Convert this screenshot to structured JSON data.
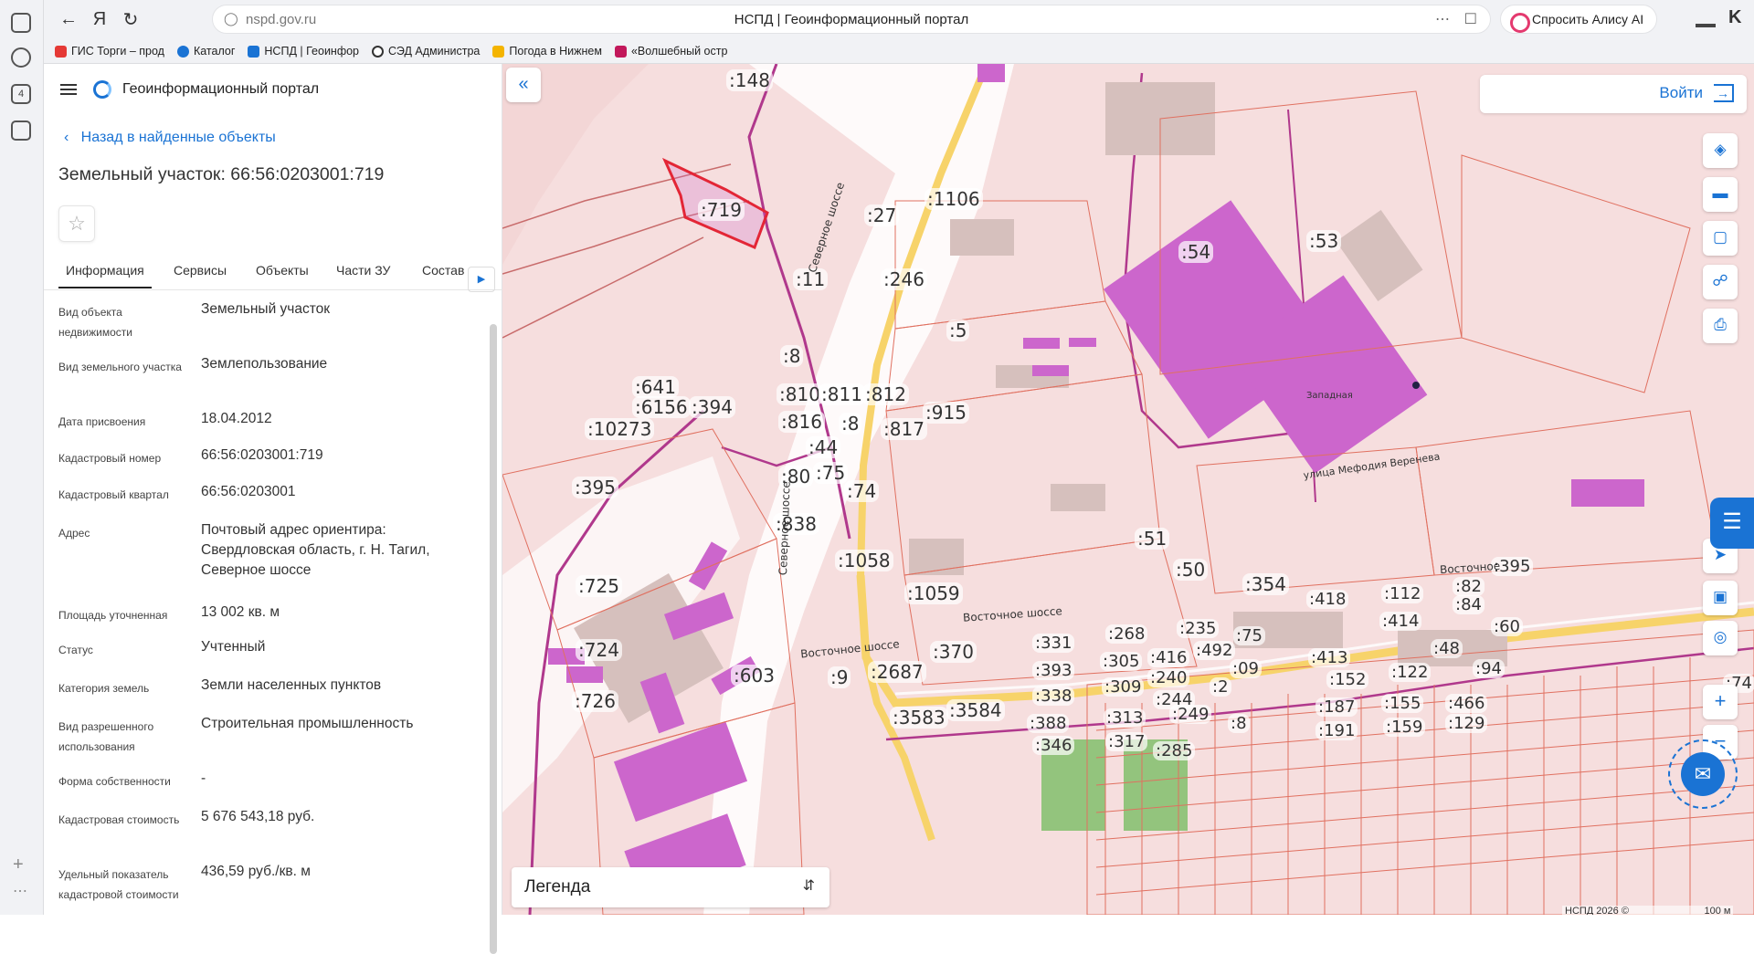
{
  "browser": {
    "url": "nspd.gov.ru",
    "tab_title": "НСПД | Геоинформационный портал",
    "alice_label": "Спросить Алису AI",
    "bookmarks": [
      {
        "label": "ГИС Торги – прод",
        "color": "#e53935"
      },
      {
        "label": "Каталог",
        "color": "#1a73d4"
      },
      {
        "label": "НСПД | Геоинфор",
        "color": "#1a73d4"
      },
      {
        "label": "СЭД Администра",
        "color": "#333333"
      },
      {
        "label": "Погода в Нижнем",
        "color": "#f4b400"
      },
      {
        "label": "«Волшебный остр",
        "color": "#c2185b"
      }
    ],
    "left_rail_tab_count": "4"
  },
  "sidebar": {
    "app_title": "Геоинформационный портал",
    "back_label": "Назад в найденные объекты",
    "object_title": "Земельный участок: 66:56:0203001:719",
    "tabs": [
      "Информация",
      "Сервисы",
      "Объекты",
      "Части ЗУ",
      "Состав"
    ],
    "rows": [
      {
        "label": "Вид объекта недвижимости",
        "value": "Земельный участок"
      },
      {
        "label": "Вид земельного участка",
        "value": "Землепользование"
      },
      {
        "label": "Дата присвоения",
        "value": "18.04.2012"
      },
      {
        "label": "Кадастровый номер",
        "value": "66:56:0203001:719"
      },
      {
        "label": "Кадастровый квартал",
        "value": "66:56:0203001"
      },
      {
        "label": "Адрес",
        "value": "Почтовый адрес ориентира: Свердловская область, г. Н. Тагил, Северное шоссе"
      },
      {
        "label": "Площадь уточненная",
        "value": "13 002 кв. м"
      },
      {
        "label": "Статус",
        "value": "Учтенный"
      },
      {
        "label": "Категория земель",
        "value": "Земли населенных пунктов"
      },
      {
        "label": "Вид разрешенного использования",
        "value": "Строительная промышленность"
      },
      {
        "label": "Форма собственности",
        "value": "-"
      },
      {
        "label": "Кадастровая стоимость",
        "value": "5 676 543,18 руб."
      },
      {
        "label": "Удельный показатель кадастровой стоимости",
        "value": "436,59 руб./кв. м"
      }
    ]
  },
  "map": {
    "login_label": "Войти",
    "legend_label": "Легенда",
    "copyright": "НСПД 2026 ©",
    "scale_label": "100 м",
    "selected_parcel": ":719",
    "parcel_labels": [
      ":148",
      ":719",
      ":1106",
      ":27",
      ":53",
      ":54",
      ":246",
      ":11",
      ":5",
      ":8",
      ":641",
      ":6156",
      ":394",
      ":810",
      ":811",
      ":812",
      ":915",
      ":816",
      ":8",
      ":817",
      ":44",
      ":10273",
      ":80",
      ":75",
      ":74",
      ":395",
      ":838",
      ":51",
      ":725",
      ":1058",
      ":50",
      ":354",
      ":1059",
      ":724",
      ":370",
      ":726",
      ":603",
      ":9",
      ":2687",
      ":3583",
      ":3584",
      ":331",
      ":268",
      ":235",
      ":393",
      ":305",
      ":416",
      ":492",
      ":338",
      ":309",
      ":240",
      ":244",
      ":2",
      ":388",
      ":313",
      ":249",
      ":346",
      ":317",
      ":285",
      ":418",
      ":112",
      ":82",
      ":395",
      ":414",
      ":84",
      ":60",
      ":413",
      ":152",
      ":122",
      ":155",
      ":187",
      ":466",
      ":159",
      ":129",
      ":191",
      ":94",
      ":48",
      ":74",
      ":8",
      ":09",
      ":75"
    ],
    "street_labels": [
      "Северное шоссе",
      "Северное шоссе",
      "Восточное шоссе",
      "Восточное шоссе",
      "Восточное",
      "улица Мефодия Веренева",
      "Западная"
    ],
    "colors": {
      "parcel_fill": "#f6dede",
      "building": "#cc66cc",
      "selected": "#e32636",
      "road": "#f7d36a",
      "rail": "#b0388c"
    }
  }
}
